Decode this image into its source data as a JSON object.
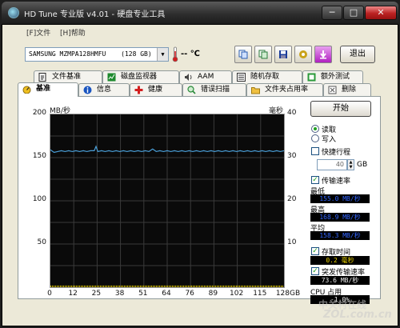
{
  "window": {
    "title": "HD Tune 专业版 v4.01 - 硬盘专业工具",
    "min_glyph": "─",
    "max_glyph": "□",
    "close_glyph": "✕"
  },
  "menu": [
    {
      "label": "[F]文件"
    },
    {
      "label": "[H]帮助"
    }
  ],
  "toolbar": {
    "drive": "SAMSUNG MZMPA128HMFU",
    "drive_capacity": "(128 GB)",
    "temperature": "-- ℃",
    "exit_label": "退出",
    "buttons": [
      {
        "icon": "copy-info-icon",
        "color": "#2a5db0"
      },
      {
        "icon": "copy-text-icon",
        "color": "#2a7a3a"
      },
      {
        "icon": "save-icon",
        "color": "#1a3c9a"
      },
      {
        "icon": "options-icon",
        "color": "#c9a21a"
      },
      {
        "icon": "download-icon",
        "color": "#b020c0"
      }
    ]
  },
  "tabs_top": [
    {
      "label": "文件基准",
      "icon": "file-benchmark-icon",
      "color": "#222"
    },
    {
      "label": "磁盘监视器",
      "icon": "disk-monitor-icon",
      "color": "#1e8a2e"
    },
    {
      "label": "AAM",
      "icon": "speaker-icon",
      "color": "#444"
    },
    {
      "label": "随机存取",
      "icon": "random-access-icon",
      "color": "#333"
    },
    {
      "label": "额外测试",
      "icon": "extra-tests-icon",
      "color": "#2a9a3a"
    }
  ],
  "tabs_bottom": [
    {
      "label": "基准",
      "icon": "benchmark-icon",
      "color": "#c59a12",
      "active": true
    },
    {
      "label": "信息",
      "icon": "info-icon",
      "color": "#1a55c0"
    },
    {
      "label": "健康",
      "icon": "health-icon",
      "color": "#d21e1e"
    },
    {
      "label": "错误扫描",
      "icon": "error-scan-icon",
      "color": "#2a8a3a"
    },
    {
      "label": "文件夹占用率",
      "icon": "folder-usage-icon",
      "color": "#d8a020"
    },
    {
      "label": "删除",
      "icon": "erase-icon",
      "color": "#555"
    }
  ],
  "controls": {
    "start_label": "开始",
    "read_label": "读取",
    "write_label": "写入",
    "mode": "read",
    "short_stroke_label": "快捷行程",
    "short_stroke_checked": false,
    "short_stroke_value": "40",
    "short_stroke_unit": "GB",
    "transfer_rate_label": "传输速率",
    "transfer_rate_checked": true,
    "min_label": "最低",
    "min_value": "155.0 MB/秒",
    "max_label": "最高",
    "max_value": "168.9 MB/秒",
    "avg_label": "平均",
    "avg_value": "158.3 MB/秒",
    "access_time_label": "存取时间",
    "access_time_checked": true,
    "access_time_value": "0.2 毫秒",
    "burst_rate_label": "突发传输速率",
    "burst_rate_checked": true,
    "burst_rate_value": "73.6 MB/秒",
    "cpu_label": "CPU 占用",
    "cpu_value": "-1.0%"
  },
  "watermark": {
    "line1": "中关村在线",
    "line2": "ZOL.com.cn"
  },
  "chart_data": {
    "type": "line",
    "ylabel_left": "MB/秒",
    "ylabel_right": "毫秒",
    "ylim_left": [
      0,
      200
    ],
    "ylim_right": [
      0,
      40
    ],
    "yticks_left": [
      200,
      150,
      100,
      50
    ],
    "yticks_right": [
      40,
      30,
      20,
      10
    ],
    "xticks": [
      "0",
      "12",
      "25",
      "38",
      "51",
      "64",
      "76",
      "89",
      "102",
      "115",
      "128GB"
    ],
    "xlim": [
      0,
      128
    ],
    "grid": true,
    "background": "#0a0a0a",
    "series": [
      {
        "color": "#4a9fd8",
        "axis": "left",
        "x": [
          0,
          2,
          4,
          6,
          8,
          10,
          12,
          14,
          16,
          18,
          20,
          22,
          24,
          25,
          26,
          28,
          30,
          32,
          34,
          36,
          38,
          40,
          42,
          44,
          46,
          48,
          50,
          52,
          54,
          56,
          58,
          60,
          62,
          64,
          66,
          68,
          70,
          72,
          74,
          76,
          78,
          80,
          82,
          84,
          86,
          88,
          90,
          92,
          94,
          96,
          98,
          100,
          102,
          104,
          106,
          108,
          110,
          112,
          114,
          116,
          118,
          120,
          122,
          124,
          126,
          128
        ],
        "y": [
          159,
          156,
          157,
          158,
          157,
          158,
          157,
          158,
          157,
          158,
          157,
          158,
          158,
          163,
          157,
          158,
          157,
          158,
          157,
          158,
          157,
          158,
          157,
          158,
          157,
          158,
          157,
          158,
          157,
          160,
          157,
          158,
          157,
          158,
          157,
          158,
          157,
          158,
          157,
          158,
          157,
          158,
          157,
          158,
          157,
          158,
          157,
          158,
          157,
          158,
          157,
          158,
          157,
          158,
          157,
          158,
          157,
          158,
          157,
          158,
          157,
          158,
          157,
          158,
          157,
          158
        ]
      },
      {
        "color": "#e8d000",
        "axis": "right",
        "x": [
          0,
          128
        ],
        "y": [
          0.2,
          0.2
        ]
      }
    ]
  }
}
